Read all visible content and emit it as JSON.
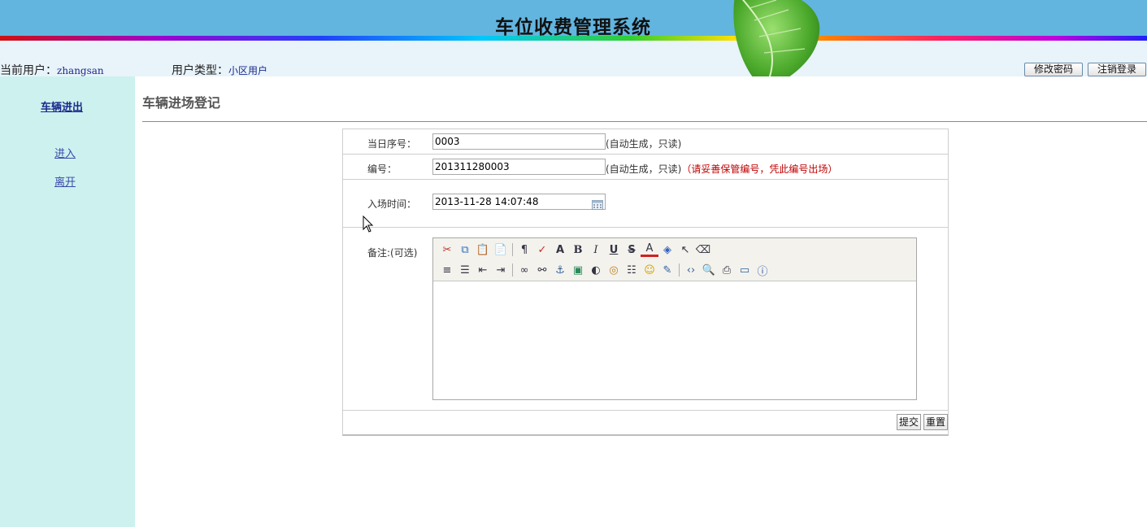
{
  "header": {
    "app_title": "车位收费管理系统",
    "current_user_label": "当前用户：",
    "current_user_value": "zhangsan",
    "user_type_label": "用户类型：",
    "user_type_value": "小区用户",
    "change_password_label": "修改密码",
    "logout_label": "注销登录"
  },
  "sidebar": {
    "section_title": "车辆进出",
    "items": [
      {
        "label": "进入"
      },
      {
        "label": "离开"
      }
    ]
  },
  "main": {
    "title": "车辆进场登记",
    "form": {
      "daily_seq": {
        "label": "当日序号：",
        "value": "0003",
        "note": "(自动生成，只读)"
      },
      "number": {
        "label": "编号：",
        "value": "201311280003",
        "note": "(自动生成，只读)",
        "warning": "（请妥善保管编号，凭此编号出场）"
      },
      "entry_time": {
        "label": "入场时间：",
        "value": "2013-11-28 14:07:48"
      },
      "remarks": {
        "label": "备注:(可选)",
        "value": ""
      },
      "submit_label": "提交",
      "reset_label": "重置"
    }
  },
  "colors": {
    "header_band": "#62b5df",
    "sidebar_bg": "#cdf1ee",
    "warning": "#c00000",
    "link": "#3a4aaa"
  },
  "icons": {
    "toolbar_row1": [
      "cut-icon",
      "copy-icon",
      "paste-icon",
      "paste-text-icon",
      "paragraph-format-icon",
      "spellcheck-icon",
      "font-size-icon",
      "bold-icon",
      "italic-icon",
      "underline-icon",
      "strikethrough-icon",
      "font-color-icon",
      "background-color-icon",
      "select-all-icon",
      "remove-format-icon"
    ],
    "toolbar_row2": [
      "align-left-icon",
      "ordered-list-icon",
      "outdent-icon",
      "indent-icon",
      "link-icon",
      "unlink-icon",
      "anchor-icon",
      "image-icon",
      "media-icon",
      "flash-icon",
      "horizontal-rule-icon",
      "emoticon-icon",
      "insert-special-icon",
      "source-code-icon",
      "preview-icon",
      "print-icon",
      "fullscreen-icon",
      "about-icon"
    ]
  }
}
